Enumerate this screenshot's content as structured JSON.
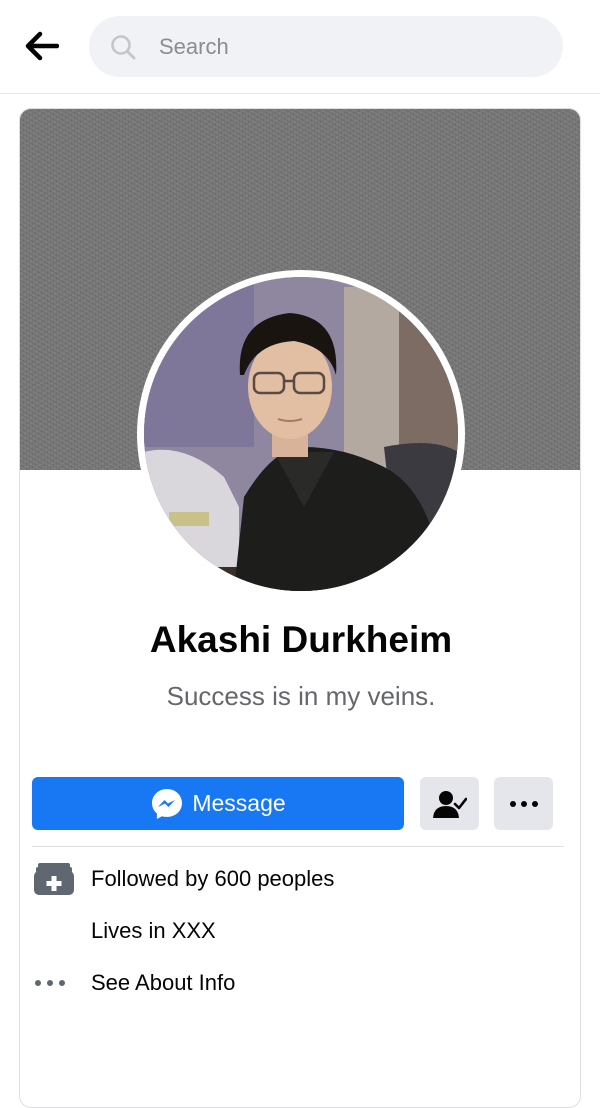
{
  "header": {
    "search": {
      "placeholder": "Search",
      "value": ""
    },
    "icons": {
      "back": "arrow-left-icon",
      "search": "search-icon"
    }
  },
  "profile": {
    "name": "Akashi Durkheim",
    "bio": "Success is in my veins."
  },
  "actions": {
    "message_label": "Message",
    "icons": {
      "message": "messenger-icon",
      "friend": "friends-check-icon",
      "more": "more-dots-icon"
    }
  },
  "info": {
    "followers": "Followed by 600 peoples",
    "lives": "Lives in XXX",
    "about": "See About Info",
    "icons": {
      "followers": "followers-icon",
      "about": "more-dots-icon"
    }
  },
  "colors": {
    "accent": "#1877f2",
    "secondary_button": "#e4e6eb",
    "muted_text": "#65676b",
    "search_bg": "#f0f2f5"
  }
}
